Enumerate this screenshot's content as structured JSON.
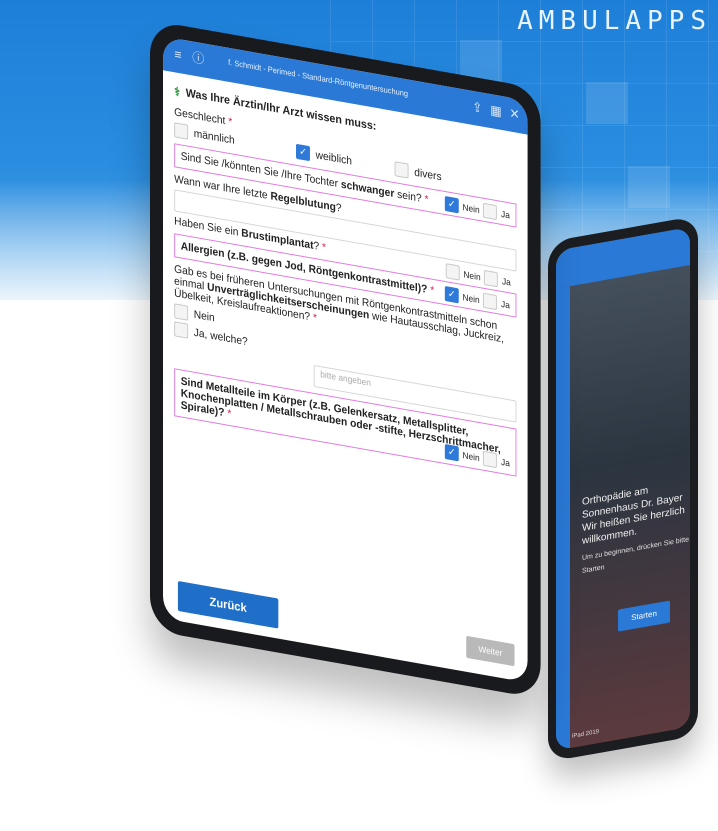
{
  "brand": {
    "text": "AMBULAPPS"
  },
  "colors": {
    "accent": "#2a79d6",
    "required": "#d9254f",
    "highlight_border": "#e27be0"
  },
  "main_tablet": {
    "header_title": "f. Schmidt - Perimed - Standard-Röntgenuntersuchung",
    "header_icons": [
      "menu-icon",
      "info-icon",
      "share-icon",
      "grid-icon",
      "close-icon"
    ],
    "section_title": "Was Ihre Ärztin/Ihr Arzt wissen muss:",
    "gender": {
      "label": "Geschlecht",
      "options": [
        {
          "label": "männlich",
          "checked": false
        },
        {
          "label": "weiblich",
          "checked": true
        },
        {
          "label": "divers",
          "checked": false
        }
      ]
    },
    "pregnant": {
      "label_pre": "Sind Sie /könnten Sie /Ihre Tochter",
      "label_bold": "schwanger",
      "label_post": "sein?",
      "yes": "Ja",
      "no": "Nein",
      "no_checked": true
    },
    "period": {
      "label_pre": "Wann war Ihre letzte",
      "label_bold": "Regelblutung",
      "label_post": "?"
    },
    "implant": {
      "label_pre": "Haben Sie ein",
      "label_bold": "Brustimplantat",
      "label_post": "?",
      "yes": "Ja",
      "no": "Nein",
      "no_checked": false
    },
    "allergies": {
      "label": "Allergien (z.B. gegen Jod, Röntgenkontrastmittel)?",
      "yes": "Ja",
      "no": "Nein",
      "no_checked": true
    },
    "intolerance": {
      "label_pre": "Gab es bei früheren Untersuchungen mit Röntgenkontrastmitteln schon einmal",
      "label_bold": "Unverträglichkeitserscheinungen",
      "label_post": "wie Hautausschlag, Juckreiz, Übelkeit, Kreislaufreaktionen?",
      "opt_no": "Nein",
      "opt_yes": "Ja, welche?",
      "placeholder": "bitte angeben"
    },
    "metal": {
      "label": "Sind Metallteile im Körper (z.B. Gelenkersatz, Metallsplitter, Knochenplatten / Metallschrauben oder -stifte, Herzschrittmacher, Spirale)?",
      "yes": "Ja",
      "no": "Nein",
      "no_checked": true
    },
    "back_button": "Zurück",
    "next_button": "Weiter"
  },
  "second_tablet": {
    "headline": "Orthopädie am Sonnenhaus Dr. Bayer",
    "subline": "Wir heißen Sie herzlich willkommen.",
    "small": "Um zu beginnen, drücken Sie bitte auf Starten",
    "start_button": "Starten",
    "footer": "iPad 2019"
  }
}
